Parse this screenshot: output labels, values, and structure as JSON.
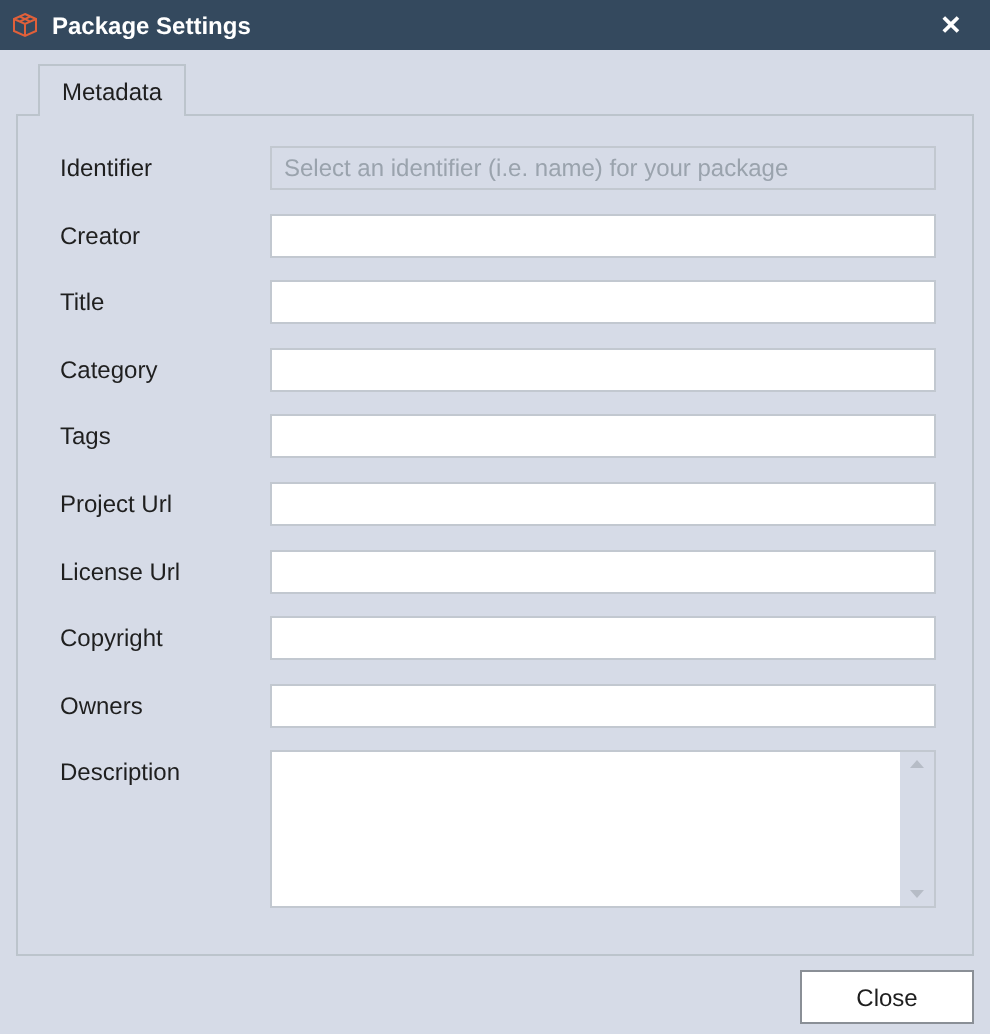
{
  "window": {
    "title": "Package Settings",
    "close": "✕"
  },
  "tabs": [
    {
      "label": "Metadata",
      "selected": true
    }
  ],
  "fields": [
    {
      "label": "Identifier",
      "kind": "text",
      "placeholder": "Select an identifier (i.e. name) for your package",
      "disabled": true
    },
    {
      "label": "Creator",
      "kind": "text",
      "disabled": false
    },
    {
      "label": "Title",
      "kind": "text",
      "disabled": false
    },
    {
      "label": "Category",
      "kind": "text",
      "disabled": false
    },
    {
      "label": "Tags",
      "kind": "text",
      "disabled": false
    },
    {
      "label": "Project Url",
      "kind": "text",
      "disabled": false
    },
    {
      "label": "License Url",
      "kind": "text",
      "disabled": false
    },
    {
      "label": "Copyright",
      "kind": "text",
      "disabled": false
    },
    {
      "label": "Owners",
      "kind": "text",
      "disabled": false
    },
    {
      "label": "Description",
      "kind": "multiline",
      "disabled": false
    }
  ],
  "buttons": [
    {
      "label": "Close"
    }
  ]
}
